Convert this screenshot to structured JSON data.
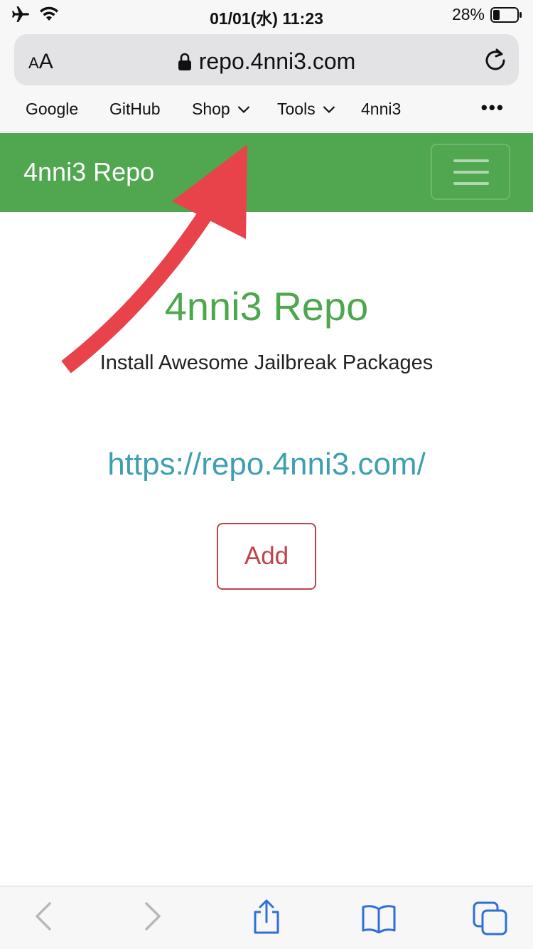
{
  "status_bar": {
    "time": "01/01(水) 11:23",
    "battery": "28%",
    "icons": [
      "airplane-icon",
      "wifi-icon",
      "battery-icon"
    ]
  },
  "browser": {
    "text_size_label": "AA",
    "url": "repo.4nni3.com",
    "favorites": [
      {
        "label": "Google"
      },
      {
        "label": "GitHub"
      },
      {
        "label": "Shop"
      },
      {
        "label": "Tools"
      },
      {
        "label": "4nni3"
      }
    ],
    "more_label": "•••"
  },
  "navbar": {
    "brand": "4nni3 Repo",
    "color": "#50a74f"
  },
  "main": {
    "title": "4nni3 Repo",
    "subtitle": "Install Awesome Jailbreak Packages",
    "repo_url": "https://repo.4nni3.com/",
    "add_label": "Add"
  },
  "annotation": {
    "arrow_color": "#e8434b"
  },
  "toolbar": {
    "icons": [
      "back-icon",
      "forward-icon",
      "share-icon",
      "bookmarks-icon",
      "tabs-icon"
    ]
  }
}
